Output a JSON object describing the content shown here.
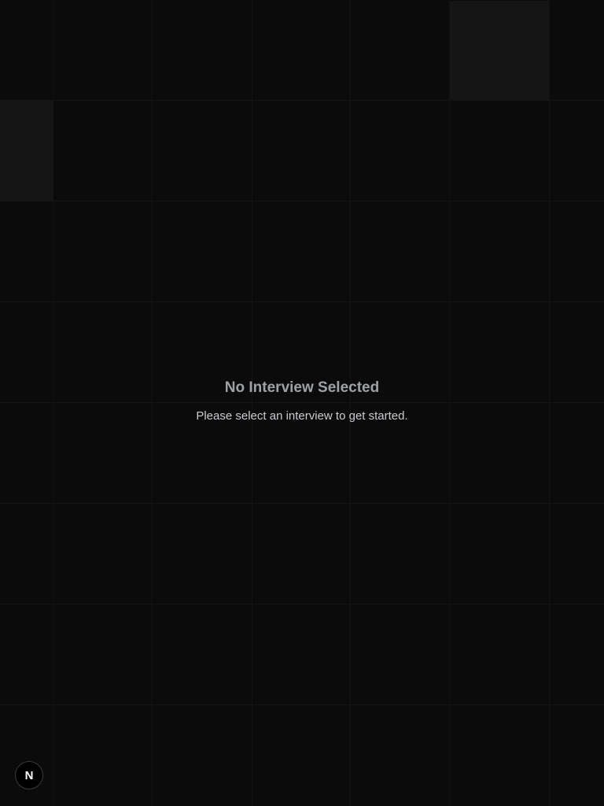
{
  "empty_state": {
    "title": "No Interview Selected",
    "description": "Please select an interview to get started."
  },
  "dev_indicator": {
    "glyph": "N",
    "icon": "nextjs-logo-icon"
  },
  "colors": {
    "background": "#0b0b0c",
    "title": "#9ea2a8",
    "description": "#c9ccd1"
  }
}
